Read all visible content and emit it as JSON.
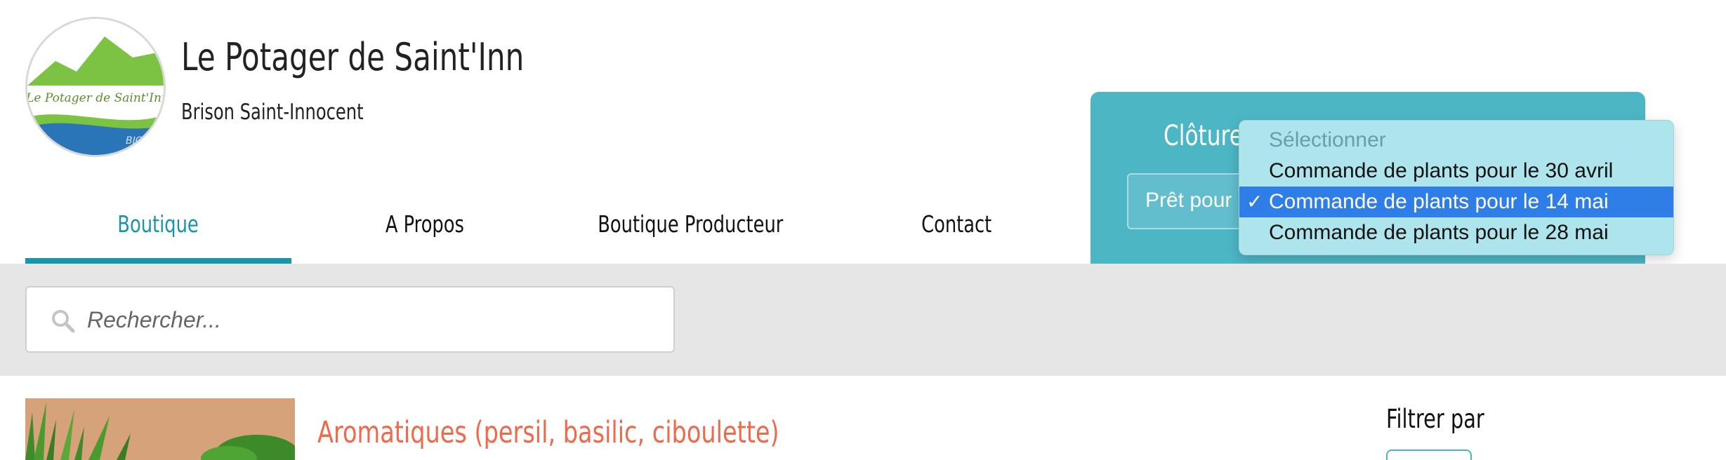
{
  "brand": {
    "title": "Le Potager de Saint'Inn",
    "subtitle": "Brison Saint-Innocent",
    "logo_text": "Le Potager de Saint'Inn",
    "logo_badge": "BIO"
  },
  "nav": {
    "items": [
      {
        "label": "Boutique",
        "active": true
      },
      {
        "label": "A Propos",
        "active": false
      },
      {
        "label": "Boutique Producteur",
        "active": false
      },
      {
        "label": "Contact",
        "active": false
      }
    ]
  },
  "order_panel": {
    "title_visible": "Clôture",
    "select_text_visible": "Prêt pour"
  },
  "dropdown": {
    "options": [
      {
        "label": "Sélectionner",
        "placeholder": true
      },
      {
        "label": "Commande de plants pour le 30 avril"
      },
      {
        "label": "Commande de plants pour le 14 mai",
        "selected": true
      },
      {
        "label": "Commande de plants pour le 28 mai"
      }
    ],
    "check_mark": "✓"
  },
  "search": {
    "placeholder": "Rechercher..."
  },
  "product": {
    "title": "Aromatiques (persil, basilic, ciboulette)"
  },
  "sidebar": {
    "filter_title": "Filtrer par"
  },
  "colors": {
    "accent": "#1a95a8",
    "panel": "#4db6c5",
    "product_title": "#ee6a4a",
    "selected_option": "#2f7ee8"
  }
}
